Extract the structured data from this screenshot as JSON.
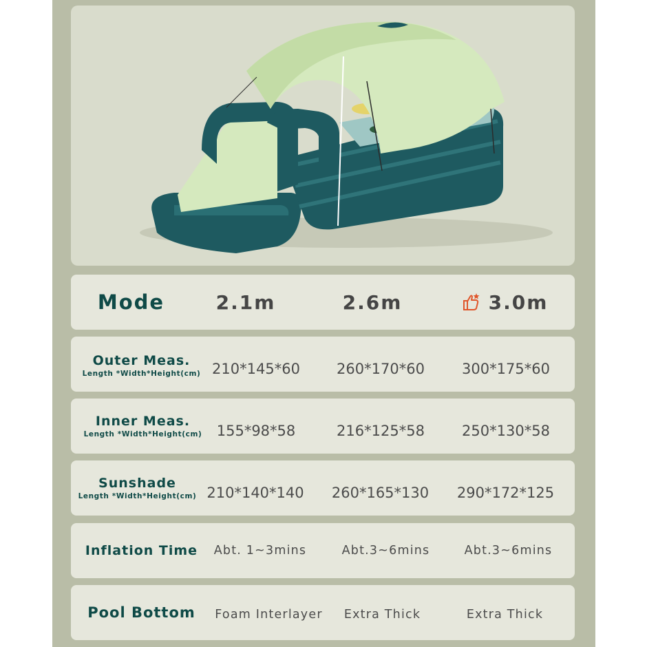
{
  "product": {
    "image_icon": "inflatable-pool-with-slide-and-sunshade"
  },
  "table": {
    "header": {
      "label": "Mode",
      "values": [
        "2.1m",
        "2.6m",
        "3.0m"
      ],
      "recommended_icon": "thumbs-up-star-icon"
    },
    "rows": [
      {
        "label": "Outer Meas.",
        "sublabel": "Length *Width*Height(cm)",
        "values": [
          "210*145*60",
          "260*170*60",
          "300*175*60"
        ]
      },
      {
        "label": "Inner Meas.",
        "sublabel": "Length *Width*Height(cm)",
        "values": [
          "155*98*58",
          "216*125*58",
          "250*130*58"
        ]
      },
      {
        "label": "Sunshade",
        "sublabel": "Length *Width*Height(cm)",
        "values": [
          "210*140*140",
          "260*165*130",
          "290*172*125"
        ]
      },
      {
        "label": "Inflation Time",
        "values": [
          "Abt. 1~3mins",
          "Abt.3~6mins",
          "Abt.3~6mins"
        ]
      },
      {
        "label": "Pool Bottom",
        "values": [
          "Foam Interlayer",
          "Extra Thick",
          "Extra Thick"
        ]
      }
    ]
  },
  "colors": {
    "frame": "#b9bda7",
    "card": "#e6e7dc",
    "label": "#0f4a47",
    "accent": "#e0552a",
    "pool": "#1e5a60",
    "canopy": "#d5e9be"
  }
}
